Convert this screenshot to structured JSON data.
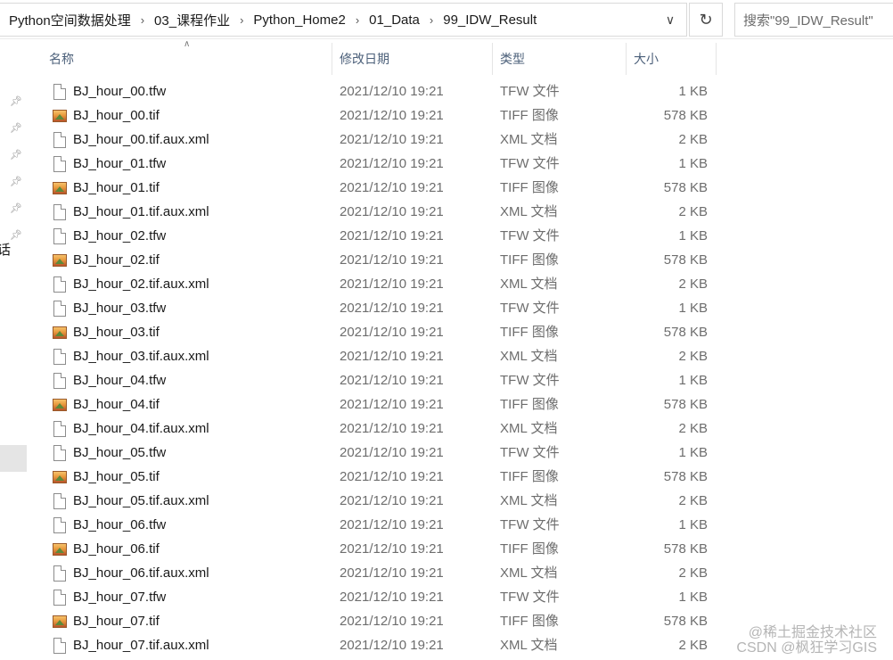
{
  "address": {
    "crumbs": [
      "Python空间数据处理",
      "03_课程作业",
      "Python_Home2",
      "01_Data",
      "99_IDW_Result"
    ],
    "search_placeholder": "搜索\"99_IDW_Result\""
  },
  "icons": {
    "crumb_separator": "chevron-right-icon",
    "dropdown": "chevron-down-icon",
    "refresh": "refresh-icon",
    "pin": "pin-icon",
    "tfw_file": "document-icon",
    "tif_file": "image-icon"
  },
  "nav": {
    "cut_text": "话"
  },
  "columns": {
    "name": "名称",
    "date": "修改日期",
    "type": "类型",
    "size": "大小"
  },
  "files": [
    {
      "name": "BJ_hour_00.tfw",
      "date": "2021/12/10 19:21",
      "type": "TFW 文件",
      "size": "1 KB",
      "icon": "doc"
    },
    {
      "name": "BJ_hour_00.tif",
      "date": "2021/12/10 19:21",
      "type": "TIFF 图像",
      "size": "578 KB",
      "icon": "img"
    },
    {
      "name": "BJ_hour_00.tif.aux.xml",
      "date": "2021/12/10 19:21",
      "type": "XML 文档",
      "size": "2 KB",
      "icon": "doc"
    },
    {
      "name": "BJ_hour_01.tfw",
      "date": "2021/12/10 19:21",
      "type": "TFW 文件",
      "size": "1 KB",
      "icon": "doc"
    },
    {
      "name": "BJ_hour_01.tif",
      "date": "2021/12/10 19:21",
      "type": "TIFF 图像",
      "size": "578 KB",
      "icon": "img"
    },
    {
      "name": "BJ_hour_01.tif.aux.xml",
      "date": "2021/12/10 19:21",
      "type": "XML 文档",
      "size": "2 KB",
      "icon": "doc"
    },
    {
      "name": "BJ_hour_02.tfw",
      "date": "2021/12/10 19:21",
      "type": "TFW 文件",
      "size": "1 KB",
      "icon": "doc"
    },
    {
      "name": "BJ_hour_02.tif",
      "date": "2021/12/10 19:21",
      "type": "TIFF 图像",
      "size": "578 KB",
      "icon": "img"
    },
    {
      "name": "BJ_hour_02.tif.aux.xml",
      "date": "2021/12/10 19:21",
      "type": "XML 文档",
      "size": "2 KB",
      "icon": "doc"
    },
    {
      "name": "BJ_hour_03.tfw",
      "date": "2021/12/10 19:21",
      "type": "TFW 文件",
      "size": "1 KB",
      "icon": "doc"
    },
    {
      "name": "BJ_hour_03.tif",
      "date": "2021/12/10 19:21",
      "type": "TIFF 图像",
      "size": "578 KB",
      "icon": "img"
    },
    {
      "name": "BJ_hour_03.tif.aux.xml",
      "date": "2021/12/10 19:21",
      "type": "XML 文档",
      "size": "2 KB",
      "icon": "doc"
    },
    {
      "name": "BJ_hour_04.tfw",
      "date": "2021/12/10 19:21",
      "type": "TFW 文件",
      "size": "1 KB",
      "icon": "doc"
    },
    {
      "name": "BJ_hour_04.tif",
      "date": "2021/12/10 19:21",
      "type": "TIFF 图像",
      "size": "578 KB",
      "icon": "img"
    },
    {
      "name": "BJ_hour_04.tif.aux.xml",
      "date": "2021/12/10 19:21",
      "type": "XML 文档",
      "size": "2 KB",
      "icon": "doc"
    },
    {
      "name": "BJ_hour_05.tfw",
      "date": "2021/12/10 19:21",
      "type": "TFW 文件",
      "size": "1 KB",
      "icon": "doc"
    },
    {
      "name": "BJ_hour_05.tif",
      "date": "2021/12/10 19:21",
      "type": "TIFF 图像",
      "size": "578 KB",
      "icon": "img"
    },
    {
      "name": "BJ_hour_05.tif.aux.xml",
      "date": "2021/12/10 19:21",
      "type": "XML 文档",
      "size": "2 KB",
      "icon": "doc"
    },
    {
      "name": "BJ_hour_06.tfw",
      "date": "2021/12/10 19:21",
      "type": "TFW 文件",
      "size": "1 KB",
      "icon": "doc"
    },
    {
      "name": "BJ_hour_06.tif",
      "date": "2021/12/10 19:21",
      "type": "TIFF 图像",
      "size": "578 KB",
      "icon": "img"
    },
    {
      "name": "BJ_hour_06.tif.aux.xml",
      "date": "2021/12/10 19:21",
      "type": "XML 文档",
      "size": "2 KB",
      "icon": "doc"
    },
    {
      "name": "BJ_hour_07.tfw",
      "date": "2021/12/10 19:21",
      "type": "TFW 文件",
      "size": "1 KB",
      "icon": "doc"
    },
    {
      "name": "BJ_hour_07.tif",
      "date": "2021/12/10 19:21",
      "type": "TIFF 图像",
      "size": "578 KB",
      "icon": "img"
    },
    {
      "name": "BJ_hour_07.tif.aux.xml",
      "date": "2021/12/10 19:21",
      "type": "XML 文档",
      "size": "2 KB",
      "icon": "doc"
    }
  ],
  "watermarks": [
    "@稀土掘金技术社区",
    "CSDN @枫狂学习GIS"
  ]
}
